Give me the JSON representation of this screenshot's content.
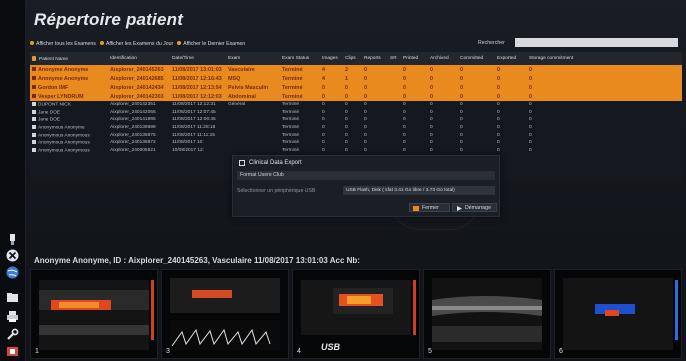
{
  "title": "Répertoire patient",
  "filters": [
    {
      "label": "Afficher tous les Examens",
      "accent": "#e39d2a"
    },
    {
      "label": "Afficher les Examens du Jour",
      "accent": "#e39d2a"
    },
    {
      "label": "Afficher le Dernier Examen",
      "accent": "#e39d2a"
    }
  ],
  "search": {
    "label": "Rechercher",
    "value": ""
  },
  "table": {
    "columns": [
      "Patient Name",
      "Identification",
      "Date/Time",
      "Exam",
      "Exam Status",
      "Images",
      "Clips",
      "Reports",
      "SR",
      "Printed",
      "Archived",
      "Committed",
      "Exported",
      "Storage commitment"
    ],
    "rows": [
      {
        "selected": true,
        "cells": [
          "Anonyme Anonyme",
          "Aixplorer_240145263",
          "11/08/2017 13:01:03",
          "Vasculaire",
          "Terminé",
          "4",
          "2",
          "0",
          "",
          "0",
          "0",
          "0",
          "0",
          "0"
        ]
      },
      {
        "selected": true,
        "cells": [
          "Anonyme Anonyme",
          "Aixplorer_240142685",
          "11/08/2017 12:16:43",
          "MSQ",
          "Terminé",
          "4",
          "1",
          "0",
          "",
          "0",
          "0",
          "0",
          "0",
          "0"
        ]
      },
      {
        "selected": true,
        "cells": [
          "Gordon IMF",
          "Aixplorer_240142434",
          "11/08/2017 12:13:54",
          "Pelvis Masculin",
          "Terminé",
          "0",
          "0",
          "0",
          "",
          "0",
          "0",
          "0",
          "0",
          "0"
        ]
      },
      {
        "selected": true,
        "cells": [
          "Vesper LYNDRUM",
          "Aixplorer_240142303",
          "11/08/2017 12:12:03",
          "Abdominal",
          "Terminé",
          "0",
          "0",
          "0",
          "",
          "0",
          "0",
          "0",
          "0",
          "0"
        ]
      },
      {
        "selected": false,
        "cells": [
          "DUPONT NICK",
          "Aixplorer_240142351",
          "11/08/2017 12:12:31",
          "Général",
          "Terminé",
          "0",
          "0",
          "0",
          "",
          "0",
          "0",
          "0",
          "0",
          "0"
        ]
      },
      {
        "selected": false,
        "cells": [
          "Jane DOE",
          "Aixplorer_240142065",
          "11/08/2017 12:07:45",
          "",
          "Terminé",
          "0",
          "0",
          "0",
          "",
          "0",
          "0",
          "0",
          "0",
          "0"
        ]
      },
      {
        "selected": false,
        "cells": [
          "Jane DOE",
          "Aixplorer_240141895",
          "11/08/2017 12:06:45",
          "",
          "Terminé",
          "0",
          "0",
          "0",
          "",
          "0",
          "0",
          "0",
          "0",
          "0"
        ]
      },
      {
        "selected": false,
        "cells": [
          "Anonymous Anonyme",
          "Aixplorer_240139698",
          "11/08/2017 11:28:18",
          "",
          "Terminé",
          "0",
          "0",
          "0",
          "",
          "0",
          "0",
          "0",
          "0",
          "0"
        ]
      },
      {
        "selected": false,
        "cells": [
          "Anonymous Anonymous",
          "Aixplorer_240136875",
          "11/08/2017 11:11:15",
          "",
          "Terminé",
          "0",
          "0",
          "0",
          "",
          "0",
          "0",
          "0",
          "0",
          "0"
        ]
      },
      {
        "selected": false,
        "cells": [
          "Anonymous Anonymous",
          "Aixplorer_240136872",
          "11/08/2017 10:",
          "",
          "Terminé",
          "0",
          "0",
          "0",
          "",
          "0",
          "0",
          "0",
          "0",
          "0"
        ]
      },
      {
        "selected": false,
        "cells": [
          "Anonymous Anonymous",
          "Aixplorer_240005521",
          "10/08/2017 12:",
          "",
          "Terminé",
          "0",
          "0",
          "0",
          "",
          "0",
          "0",
          "0",
          "0",
          "0"
        ]
      }
    ]
  },
  "dialog": {
    "title": "Clinical Data Export",
    "format": "Format Usere Club",
    "dest_label": "Sélectionner un périphérique USB",
    "dest_value": "USB Flash, Disk ( sfat 3.41 Go libre / 3.73 Go total)",
    "cancel_label": "Fermer",
    "start_label": "Démarrage"
  },
  "study_label": "Anonyme Anonyme, ID : Aixplorer_240145263, Vasculaire 11/08/2017 13:01:03 Acc Nb:",
  "thumbnails": [
    {
      "number": "1",
      "kind": "doppler"
    },
    {
      "number": "3",
      "kind": "spectral"
    },
    {
      "number": "4",
      "kind": "doppler",
      "logo": "USB"
    },
    {
      "number": "5",
      "kind": "bmode"
    },
    {
      "number": "6",
      "kind": "doppler-small"
    }
  ],
  "rail_icons": [
    "usb-icon",
    "close-icon",
    "globe-icon",
    "folder-icon",
    "print-icon",
    "wrench-icon",
    "power-icon"
  ],
  "colors": {
    "accent": "#e39d2a",
    "selected_row": "#e88a1e",
    "background": "#14171d"
  }
}
